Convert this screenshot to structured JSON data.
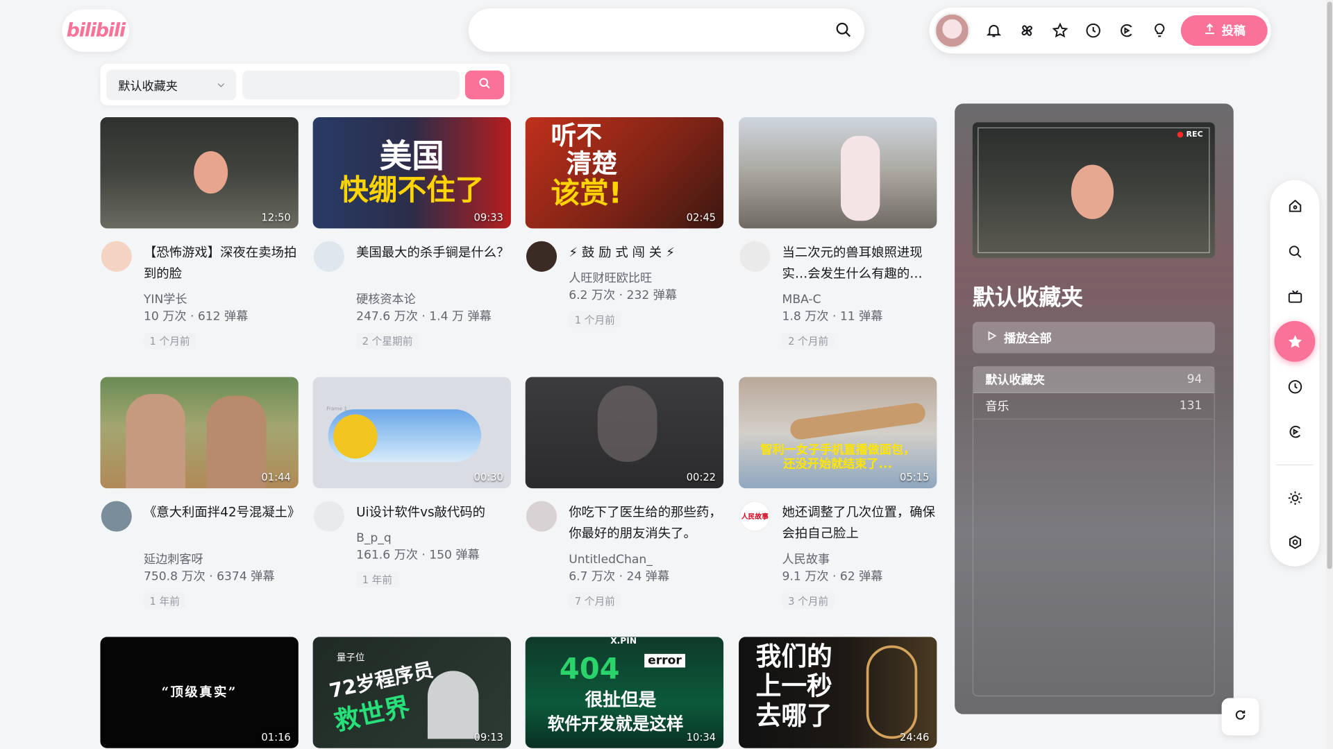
{
  "brand": {
    "logo_text": "bilibili",
    "accent": "#fb7299"
  },
  "header": {
    "search": {
      "placeholder": ""
    },
    "upload_label": "投稿",
    "icons": [
      "bell-icon",
      "fan-icon",
      "star-icon",
      "clock-icon",
      "history-icon",
      "bulb-icon"
    ]
  },
  "filter": {
    "folder_selected": "默认收藏夹",
    "input_placeholder": ""
  },
  "videos": [
    {
      "title": "【恐怖游戏】深夜在卖场拍到的脸",
      "author": "YIN学长",
      "stats": "10 万次 · 612 弹幕",
      "age": "1 个月前",
      "duration": "12:50"
    },
    {
      "title": "美国最大的杀手锏是什么？",
      "author": "硬核资本论",
      "stats": "247.6 万次 · 1.4 万 弹幕",
      "age": "2 个星期前",
      "duration": "09:33",
      "thumb_text1": "美国",
      "thumb_text2": "快绷不住了"
    },
    {
      "title": "⚡ 鼓 励 式 闯 关 ⚡",
      "author": "人旺财旺欧比旺",
      "stats": "6.2 万次 · 232 弹幕",
      "age": "1 个月前",
      "duration": "02:45",
      "thumb_text1": "听不",
      "thumb_text2": "清楚",
      "thumb_text3": "该赏!"
    },
    {
      "title": "当二次元的兽耳娘照进现实…会发生什么有趣的…",
      "author": "MBA-C",
      "stats": "1.8 万次 · 11 弹幕",
      "age": "2 个月前",
      "duration": ""
    },
    {
      "title": "《意大利面拌42号混凝土》",
      "author": "延边刺客呀",
      "stats": "750.8 万次 · 6374 弹幕",
      "age": "1 年前",
      "duration": "01:44"
    },
    {
      "title": "Ui设计软件vs敲代码的",
      "author": "B_p_q",
      "stats": "161.6 万次 · 150 弹幕",
      "age": "1 年前",
      "duration": "00:30",
      "thumb_text1": "Frame 1"
    },
    {
      "title": "你吃下了医生给的那些药，你最好的朋友消失了。",
      "author": "UntitledChan_",
      "stats": "6.7 万次 · 24 弹幕",
      "age": "7 个月前",
      "duration": "00:22"
    },
    {
      "title": "她还调整了几次位置，确保会拍自己脸上",
      "author": "人民故事",
      "stats": "9.1 万次 · 62 弹幕",
      "age": "3 个月前",
      "duration": "05:15",
      "thumb_text1": "智利一女子手机直播做面包，",
      "thumb_text2": "还没开始就结束了...",
      "avatar_text": "人民故事"
    },
    {
      "title": "",
      "author": "",
      "stats": "",
      "age": "",
      "duration": "01:16",
      "thumb_text1": "“顶级真实”"
    },
    {
      "title": "",
      "author": "",
      "stats": "",
      "age": "",
      "duration": "09:13",
      "thumb_text1": "72岁程序员",
      "thumb_text2": "救世界",
      "thumb_text3": "量子位"
    },
    {
      "title": "",
      "author": "",
      "stats": "",
      "age": "",
      "duration": "10:34",
      "thumb_text1": "404",
      "thumb_text2": "很扯但是",
      "thumb_text3": "软件开发就是这样",
      "thumb_text4": "error",
      "thumb_text5": "X.PIN"
    },
    {
      "title": "",
      "author": "",
      "stats": "",
      "age": "",
      "duration": "24:46",
      "thumb_text1": "我们的",
      "thumb_text2": "上一秒",
      "thumb_text3": "去哪了"
    }
  ],
  "panel": {
    "title": "默认收藏夹",
    "play_all": "播放全部",
    "rec_label": "REC",
    "folders": [
      {
        "name": "默认收藏夹",
        "count": "94"
      },
      {
        "name": "音乐",
        "count": "131"
      }
    ]
  },
  "sidebar": [
    "home-icon",
    "search-icon",
    "tv-icon",
    "star-icon",
    "clock-icon",
    "history-icon",
    "sun-icon",
    "settings-icon"
  ]
}
